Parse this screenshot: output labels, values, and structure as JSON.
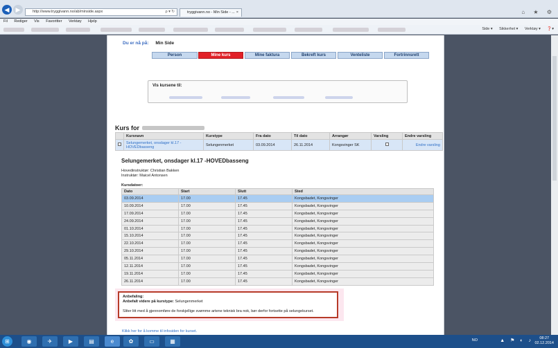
{
  "browser": {
    "address_url": "http://www.tryggivann.no/ab/minside.aspx",
    "address_tools": "ρ ▾ ↻",
    "tab_title": "tryggivann.no - Min Side - ...",
    "tab_close": "×",
    "window_controls": "⌂ ★ ⚙",
    "menu": [
      "Fil",
      "Rediger",
      "Vis",
      "Favoritter",
      "Verktøy",
      "Hjelp"
    ],
    "command_bar": [
      "Side ▾",
      "Sikkerhet ▾",
      "Verktøy ▾",
      "❓▾"
    ]
  },
  "breadcrumb": {
    "label": "Du er nå på:",
    "value": "Min Side"
  },
  "tabs": [
    {
      "label": "Person",
      "active": false
    },
    {
      "label": "Mine kurs",
      "active": true
    },
    {
      "label": "Mine faktura",
      "active": false
    },
    {
      "label": "Bekreft kurs",
      "active": false
    },
    {
      "label": "Venteliste",
      "active": false
    },
    {
      "label": "Fortrinnsrett",
      "active": false
    }
  ],
  "visbox": {
    "title": "Vis kursene til:"
  },
  "kurs_heading": "Kurs for",
  "courses_table": {
    "headers": [
      "",
      "Kursnavn",
      "Kurstype",
      "Fra dato",
      "Til dato",
      "Arrangør",
      "Varsling",
      "Endre varsling"
    ],
    "row": {
      "name": "Selungemerket, onsdager kl.17 - HOVEDbasseng",
      "type": "Selungenmerket",
      "from": "03.09.2014",
      "to": "26.11.2014",
      "organizer": "Kongsvinger SK",
      "notify_link": "Endre varsling"
    }
  },
  "detail": {
    "title": "Selungemerket, onsdager kl.17 -HOVEDbasseng",
    "instructors": [
      "Hovedinstruktør: Christian Bakken",
      "Instruktør: Maicel Antonsen"
    ],
    "dates_label": "Kursdatoer:",
    "headers": [
      "Dato",
      "Start",
      "Slutt",
      "Sted"
    ],
    "rows": [
      [
        "03.09.2014",
        "17.00",
        "17.45",
        "Kongsbadet, Kongsvinger"
      ],
      [
        "10.09.2014",
        "17.00",
        "17.45",
        "Kongsbadet, Kongsvinger"
      ],
      [
        "17.09.2014",
        "17.00",
        "17.45",
        "Kongsbadet, Kongsvinger"
      ],
      [
        "24.09.2014",
        "17.00",
        "17.45",
        "Kongsbadet, Kongsvinger"
      ],
      [
        "01.10.2014",
        "17.00",
        "17.45",
        "Kongsbadet, Kongsvinger"
      ],
      [
        "15.10.2014",
        "17.00",
        "17.45",
        "Kongsbadet, Kongsvinger"
      ],
      [
        "22.10.2014",
        "17.00",
        "17.45",
        "Kongsbadet, Kongsvinger"
      ],
      [
        "29.10.2014",
        "17.00",
        "17.45",
        "Kongsbadet, Kongsvinger"
      ],
      [
        "05.11.2014",
        "17.00",
        "17.45",
        "Kongsbadet, Kongsvinger"
      ],
      [
        "12.11.2014",
        "17.00",
        "17.45",
        "Kongsbadet, Kongsvinger"
      ],
      [
        "19.11.2014",
        "17.00",
        "17.45",
        "Kongsbadet, Kongsvinger"
      ],
      [
        "26.11.2014",
        "17.00",
        "17.45",
        "Kongsbadet, Kongsvinger"
      ]
    ]
  },
  "recommendation": {
    "heading": "Anbefaling:",
    "further_label": "Anbefalt videre på kurstype:",
    "further_value": "Selungenmerket",
    "text": "Sliter litt med å gjennomføre de forskjellige svømme artene teknisk bra nok, bør derfor fortsette på selungekurset."
  },
  "footer_link": "Klikk her for å komme til infosiden for kurset.",
  "taskbar": {
    "lang": "NO",
    "time": "08:27",
    "date": "02.12.2014"
  },
  "colors": {
    "active_tab": "#e22128",
    "tab": "#c5d8ee",
    "highlight_row": "#a9cdf2",
    "reco_border": "#b63a28"
  }
}
